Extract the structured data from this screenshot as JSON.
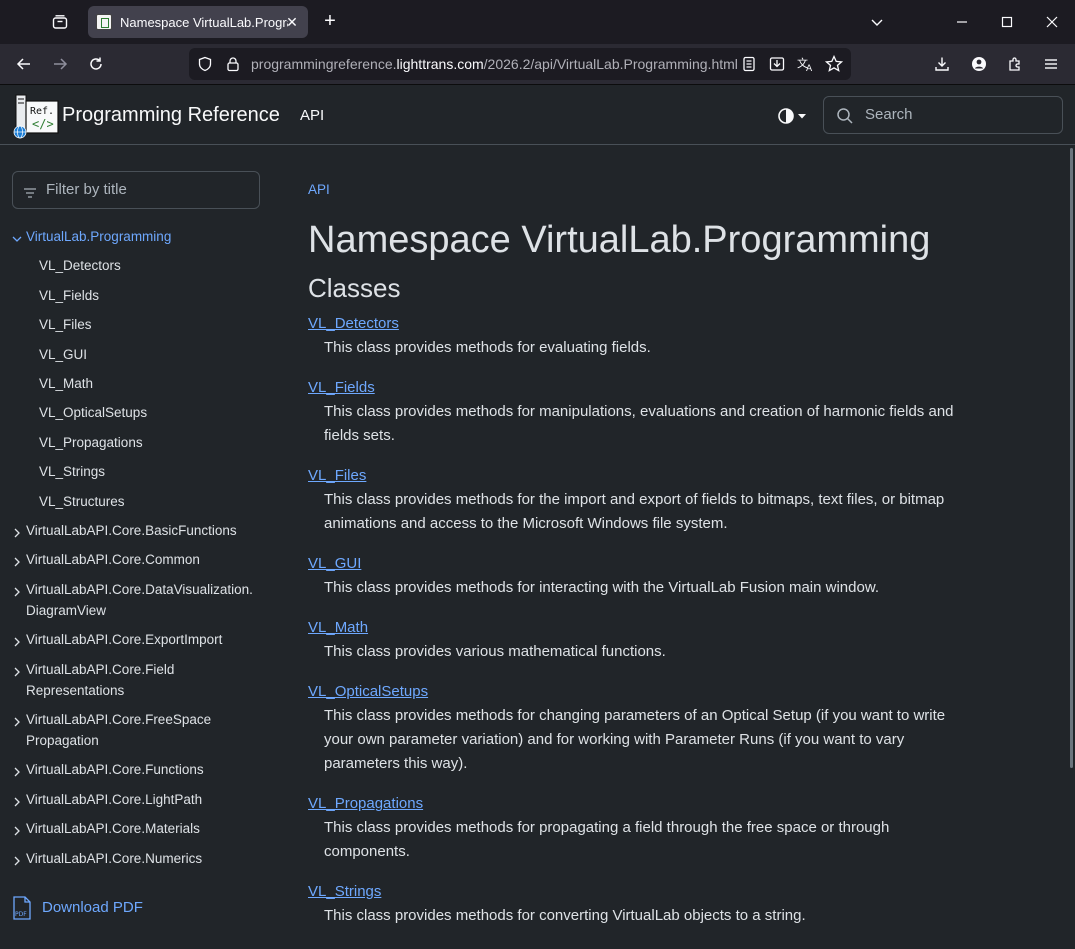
{
  "browser": {
    "tab_title": "Namespace VirtualLab.Programming",
    "url_prefix": "programmingreference.",
    "url_host": "lighttrans.com",
    "url_path": "/2026.2/api/VirtualLab.Programming.html"
  },
  "header": {
    "logo_text": "Ref.",
    "site_title": "Programming Reference",
    "nav_api": "API",
    "search_placeholder": "Search"
  },
  "sidebar": {
    "filter_placeholder": "Filter by title",
    "active_root": "VirtualLab.Programming",
    "children": [
      "VL_Detectors",
      "VL_Fields",
      "VL_Files",
      "VL_GUI",
      "VL_Math",
      "VL_OpticalSetups",
      "VL_Propagations",
      "VL_Strings",
      "VL_Structures"
    ],
    "namespaces": [
      [
        "VirtualLabAPI.Core.BasicFunctions"
      ],
      [
        "VirtualLabAPI.Core.Common"
      ],
      [
        "VirtualLabAPI.Core.DataVisualization.",
        "DiagramView"
      ],
      [
        "VirtualLabAPI.Core.ExportImport"
      ],
      [
        "VirtualLabAPI.Core.Field",
        "Representations"
      ],
      [
        "VirtualLabAPI.Core.FreeSpace",
        "Propagation"
      ],
      [
        "VirtualLabAPI.Core.Functions"
      ],
      [
        "VirtualLabAPI.Core.LightPath"
      ],
      [
        "VirtualLabAPI.Core.Materials"
      ],
      [
        "VirtualLabAPI.Core.Numerics"
      ]
    ],
    "download_pdf": "Download PDF"
  },
  "main": {
    "breadcrumb": "API",
    "title": "Namespace VirtualLab.Programming",
    "section": "Classes",
    "classes": [
      {
        "name": "VL_Detectors",
        "desc": [
          "This class provides methods for evaluating fields."
        ]
      },
      {
        "name": "VL_Fields",
        "desc": [
          "This class provides methods for manipulations, evaluations and creation of harmonic fields and",
          "fields sets."
        ]
      },
      {
        "name": "VL_Files",
        "desc": [
          "This class provides methods for the import and export of fields to bitmaps, text files, or bitmap",
          "animations and access to the Microsoft Windows file system."
        ]
      },
      {
        "name": "VL_GUI",
        "desc": [
          "This class provides methods for interacting with the VirtualLab Fusion main window."
        ]
      },
      {
        "name": "VL_Math",
        "desc": [
          "This class provides various mathematical functions."
        ]
      },
      {
        "name": "VL_OpticalSetups",
        "desc": [
          "This class provides methods for changing parameters of an Optical Setup (if you want to write",
          "your own parameter variation) and for working with Parameter Runs (if you want to vary",
          "parameters this way)."
        ]
      },
      {
        "name": "VL_Propagations",
        "desc": [
          "This class provides methods for propagating a field through the free space or through",
          "components."
        ]
      },
      {
        "name": "VL_Strings",
        "desc": [
          "This class provides methods for converting VirtualLab objects to a string."
        ]
      }
    ]
  },
  "colors": {
    "link": "#6ea8fe",
    "bg": "#212529",
    "text": "#dee2e6"
  }
}
